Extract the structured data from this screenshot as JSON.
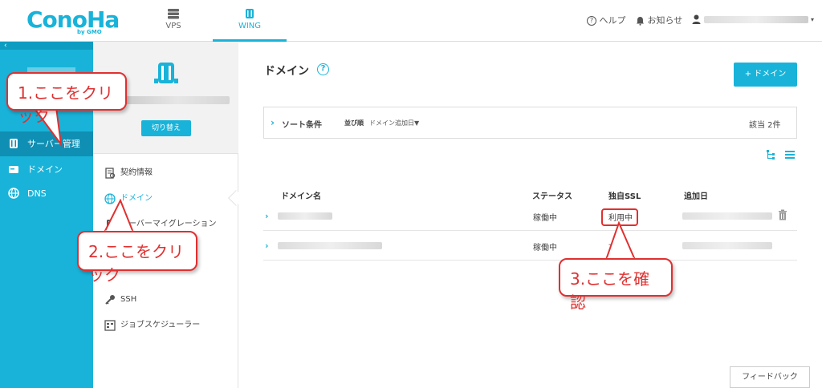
{
  "header": {
    "logo": "ConoHa",
    "logo_sub": "by GMO",
    "nav": [
      {
        "label": "VPS",
        "icon": "server-stack-icon"
      },
      {
        "label": "WING",
        "icon": "wing-server-icon"
      }
    ],
    "help_label": "ヘルプ",
    "notice_label": "お知らせ"
  },
  "sidebar": {
    "collapse_icon": "‹",
    "items": [
      {
        "label": "サーバー管理",
        "icon": "server-icon"
      },
      {
        "label": "ドメイン",
        "icon": "card-icon"
      },
      {
        "label": "DNS",
        "icon": "globe-icon"
      }
    ]
  },
  "server_panel": {
    "switch_label": "切り替え",
    "menu": [
      {
        "label": "契約情報",
        "icon": "contract-icon"
      },
      {
        "label": "ドメイン",
        "icon": "globe-icon"
      },
      {
        "label": "サーバーマイグレーション",
        "icon": "migration-icon"
      },
      {
        "label": "SSH",
        "icon": "key-icon"
      },
      {
        "label": "ジョブスケジューラー",
        "icon": "scheduler-icon"
      }
    ]
  },
  "main": {
    "title": "ドメイン",
    "help_mark": "?",
    "add_button": "+ ドメイン",
    "sort": {
      "chevron": "›",
      "label": "ソート条件",
      "order_key": "並び順",
      "order_value": "ドメイン追加日▼",
      "count": "該当 2件"
    },
    "table": {
      "headers": [
        "ドメイン名",
        "ステータス",
        "独自SSL",
        "追加日"
      ],
      "rows": [
        {
          "chevron": "›",
          "status": "稼働中",
          "ssl": "利用中"
        },
        {
          "chevron": "›",
          "status": "稼働中",
          "ssl": "-"
        }
      ]
    },
    "feedback": "フィードバック"
  },
  "callouts": [
    "1.ここをクリック",
    "2.ここをクリック",
    "3.ここを確認"
  ],
  "colors": {
    "accent": "#19b3d9",
    "callout": "#e03030"
  }
}
